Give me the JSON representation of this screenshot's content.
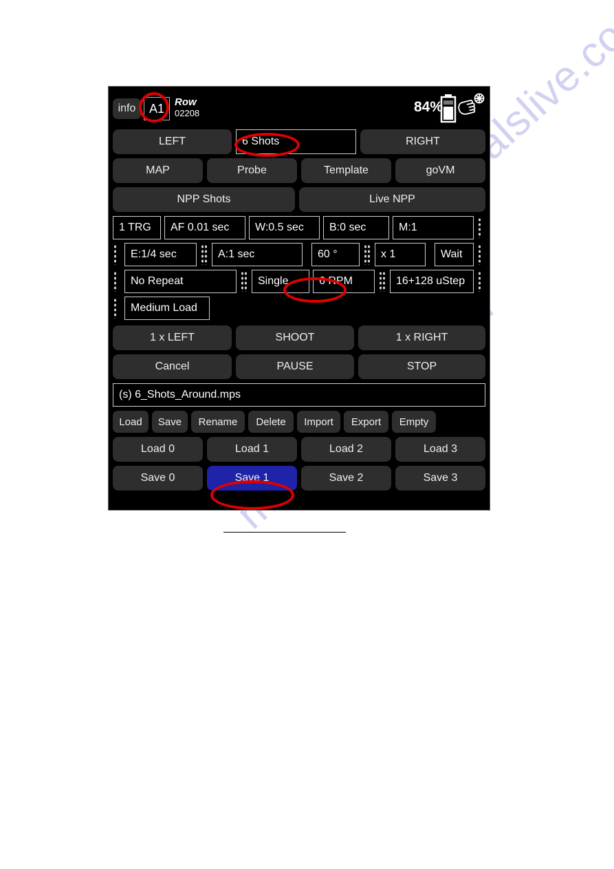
{
  "watermark": {
    "line1": "manualslive.com",
    "line2": "manualslive.com"
  },
  "header": {
    "info_label": "info",
    "channel": "A1",
    "row_label": "Row",
    "row_number": "02208",
    "battery_percent": "84%",
    "battery_icon": "battery-icon",
    "hand_icon": "hand-pointer-icon"
  },
  "nav_row1": {
    "left_label": "LEFT",
    "shots_value": "6 Shots",
    "right_label": "RIGHT"
  },
  "nav_row2": [
    "MAP",
    "Probe",
    "Template",
    "goVM"
  ],
  "nav_row3": [
    "NPP Shots",
    "Live NPP"
  ],
  "params": {
    "row1": [
      "1 TRG",
      "AF 0.01 sec",
      "W:0.5 sec",
      "B:0 sec",
      "M:1"
    ],
    "row2": [
      "E:1/4 sec",
      "A:1 sec",
      "60 °",
      "x 1",
      "Wait"
    ],
    "row3": [
      "No Repeat",
      "Single",
      "6 RPM",
      "16+128 uStep"
    ],
    "row4": [
      "Medium Load"
    ]
  },
  "actions": {
    "row1": [
      "1 x LEFT",
      "SHOOT",
      "1 x RIGHT"
    ],
    "row2": [
      "Cancel",
      "PAUSE",
      "STOP"
    ]
  },
  "file": {
    "name": "(s) 6_Shots_Around.mps",
    "ops": [
      "Load",
      "Save",
      "Rename",
      "Delete",
      "Import",
      "Export",
      "Empty"
    ],
    "loads": [
      "Load 0",
      "Load 1",
      "Load 2",
      "Load 3"
    ],
    "saves": [
      "Save 0",
      "Save 1",
      "Save 2",
      "Save 3"
    ],
    "selected_save": "Save 1"
  },
  "colors": {
    "panel_bg": "#000000",
    "button_bg": "#2e2e2e",
    "selected_blue": "#1f23a8",
    "annotation_red": "#e00000",
    "text": "#efefef"
  }
}
